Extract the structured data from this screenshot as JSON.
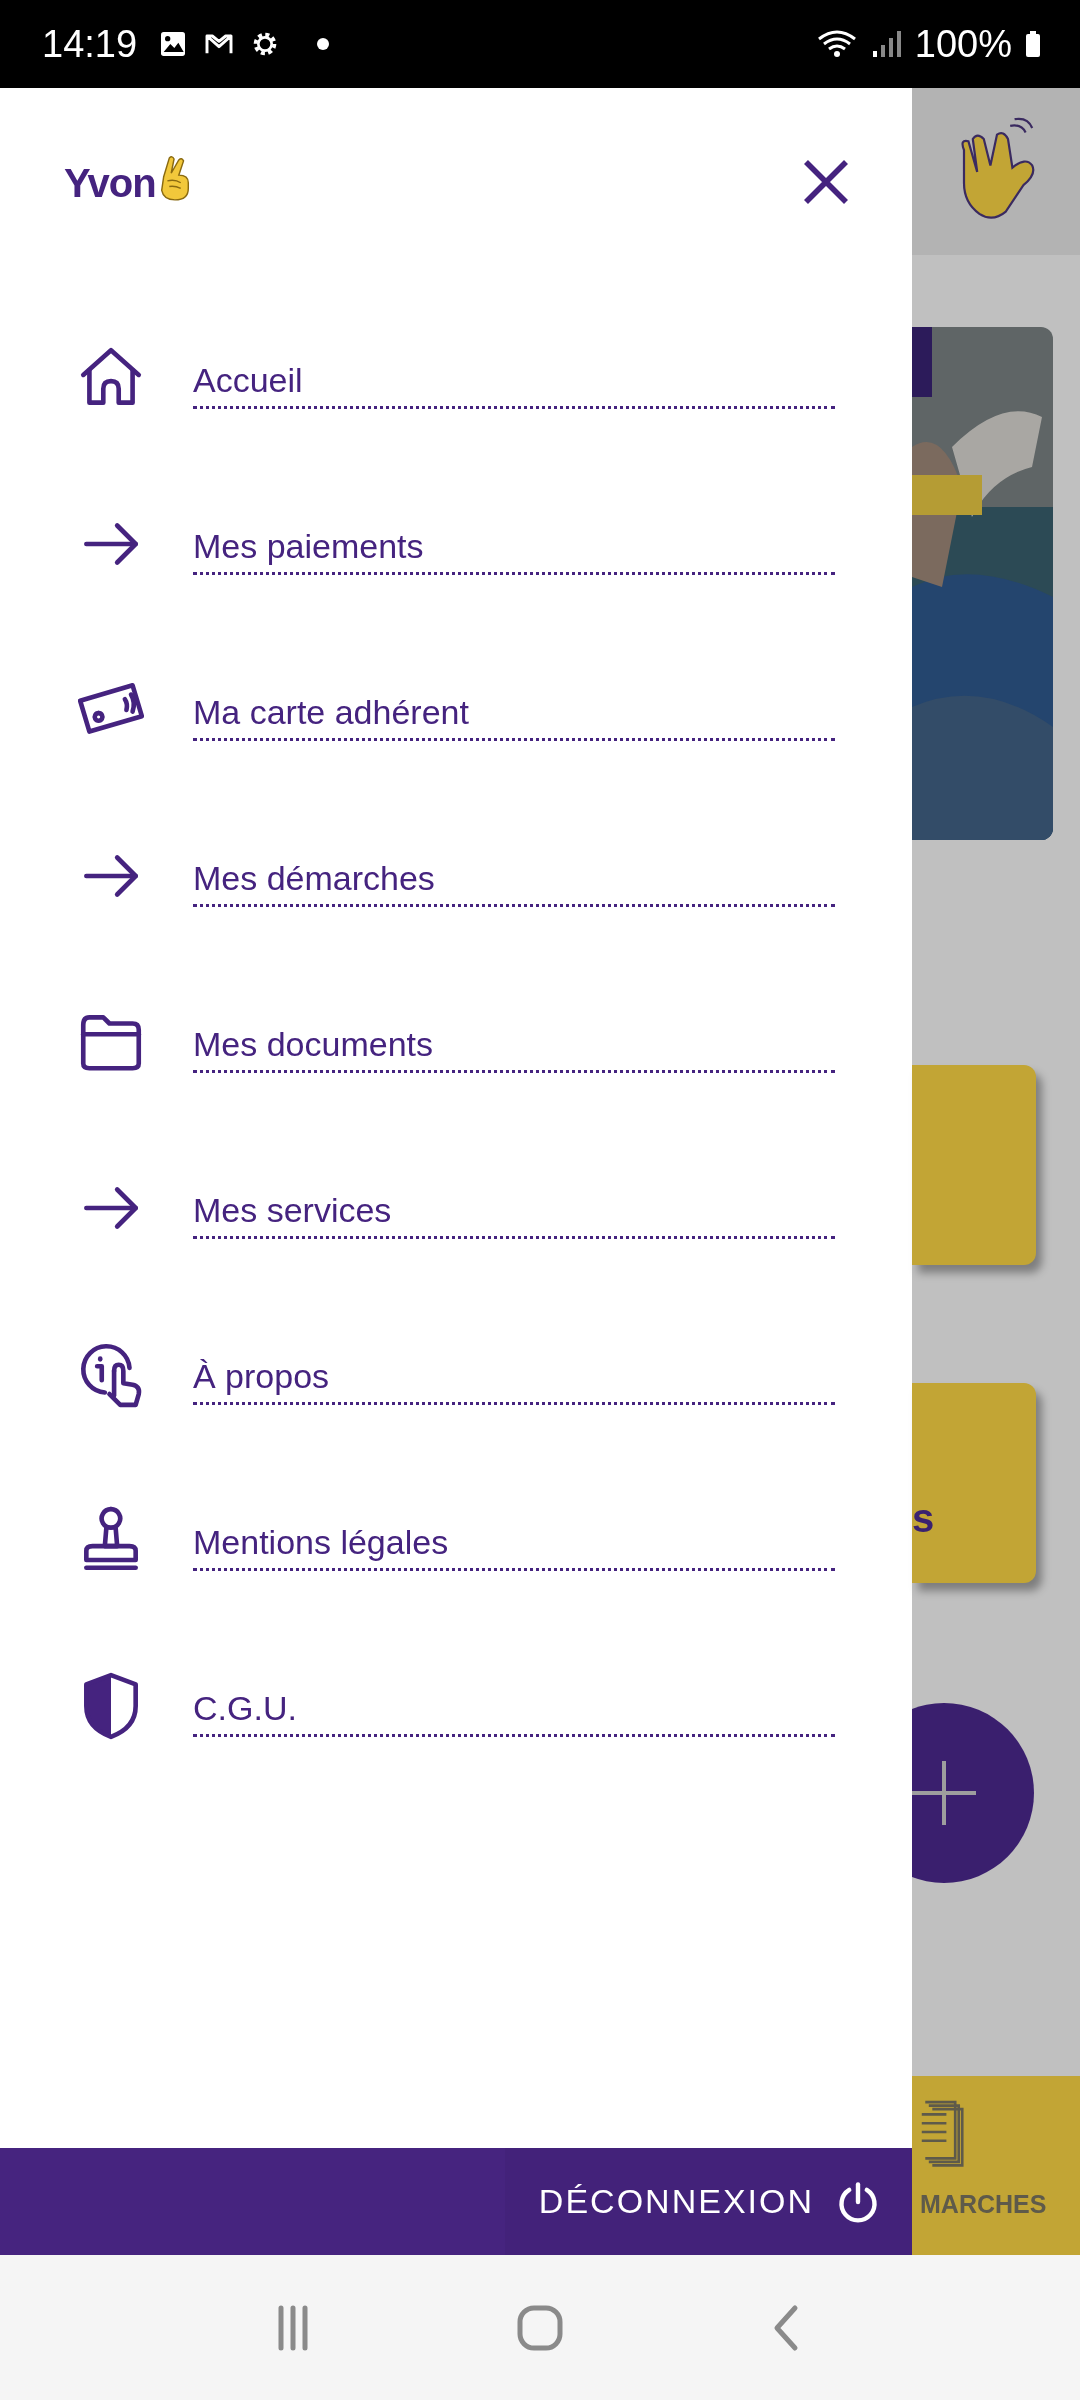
{
  "status_bar": {
    "time": "14:19",
    "battery": "100%"
  },
  "drawer": {
    "logo": "Yvon",
    "items": [
      {
        "label": "Accueil"
      },
      {
        "label": "Mes paiements"
      },
      {
        "label": "Ma carte adhérent"
      },
      {
        "label": "Mes démarches"
      },
      {
        "label": "Mes documents"
      },
      {
        "label": "Mes services"
      },
      {
        "label": "À propos"
      },
      {
        "label": "Mentions légales"
      },
      {
        "label": "C.G.U."
      }
    ],
    "logout": "DÉCONNEXION"
  },
  "background": {
    "card_text": "s",
    "tab_label": "MARCHES"
  }
}
